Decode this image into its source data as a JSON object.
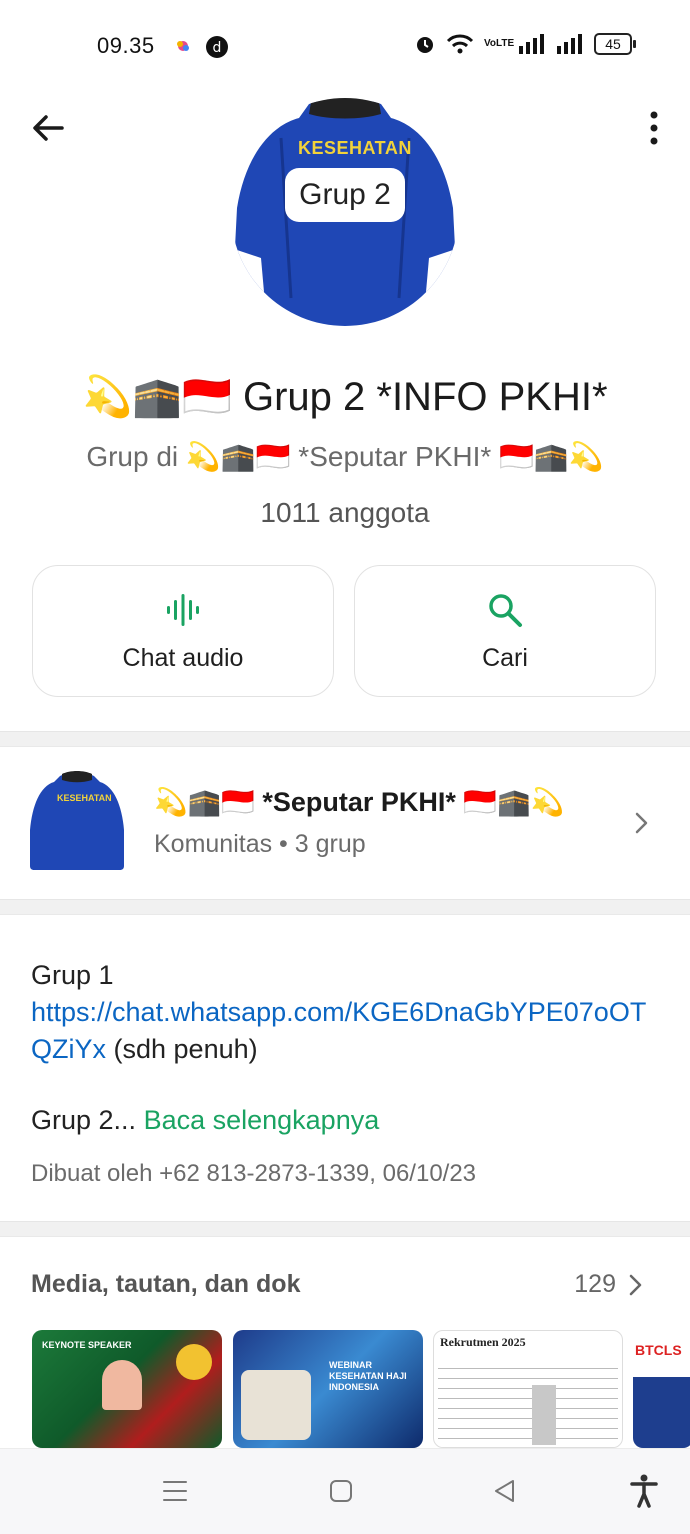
{
  "status_bar": {
    "time": "09.35",
    "network_label": "VoLTE",
    "battery": "45"
  },
  "header": {
    "avatar_text": "Grup 2",
    "avatar_jacket_text": "KESEHATAN"
  },
  "group": {
    "title": "💫🕋🇮🇩 Grup 2 *INFO PKHI*",
    "subtitle": "Grup di 💫🕋🇮🇩 *Seputar PKHI* 🇮🇩🕋💫",
    "members": "1011 anggota"
  },
  "actions": {
    "audio_label": "Chat audio",
    "search_label": "Cari"
  },
  "community": {
    "title": "💫🕋🇮🇩 *Seputar PKHI* 🇮🇩🕋💫",
    "subtitle": "Komunitas • 3 grup",
    "avatar_jacket_text": "KESEHATAN"
  },
  "description": {
    "line1": "Grup 1",
    "link": "https://chat.whatsapp.com/KGE6DnaGbYPE07oOTQZiYx",
    "after_link": " (sdh penuh)",
    "line3": "Grup 2...",
    "read_more": "Baca selengkapnya",
    "created": "Dibuat oleh +62 813-2873-1339, 06/10/23"
  },
  "media": {
    "heading": "Media, tautan, dan dok",
    "count": "129",
    "thumb1_text": "KEYNOTE SPEAKER",
    "thumb2_text": "WEBINAR KESEHATAN HAJI INDONESIA",
    "thumb3_text": "Rekrutmen 2025",
    "thumb4_text": "BTCLS"
  },
  "colors": {
    "accent_green": "#1aa362",
    "link_blue": "#0b66c3",
    "jacket_blue": "#1f47b5"
  }
}
